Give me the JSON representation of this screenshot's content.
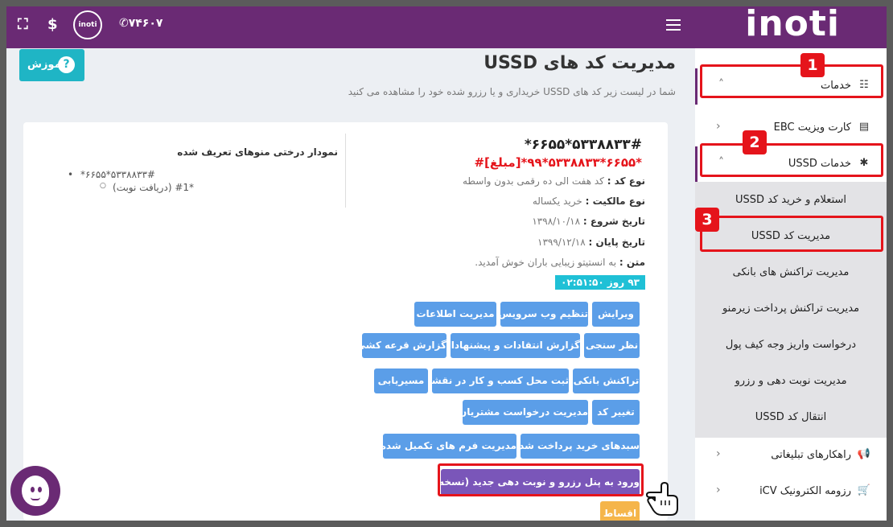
{
  "header": {
    "logo": "inoti",
    "avatar_text": "inoti",
    "phone": "۷۴۶۰۷",
    "dollar": "$"
  },
  "sidebar": {
    "items": [
      {
        "label": "خدمات",
        "icon": "sliders-icon"
      },
      {
        "label": "کارت ویزیت EBC",
        "icon": "id-card-icon"
      },
      {
        "label": "خدمات USSD",
        "icon": "gear-icon"
      },
      {
        "label": "راهکارهای تبلیغاتی",
        "icon": "megaphone-icon"
      },
      {
        "label": "رزومه الکترونیک iCV",
        "icon": "cart-icon"
      }
    ],
    "sub_items": [
      {
        "label": "استعلام و خرید کد USSD"
      },
      {
        "label": "مدیریت کد USSD"
      },
      {
        "label": "مدیریت تراکنش های بانکی"
      },
      {
        "label": "مدیریت تراکنش پرداخت زیرمنو"
      },
      {
        "label": "درخواست واریز وجه کیف پول"
      },
      {
        "label": "مدیریت نوبت دهی و رزرو"
      },
      {
        "label": "انتقال کد USSD"
      }
    ]
  },
  "badges": [
    "1",
    "2",
    "3"
  ],
  "main": {
    "tutorial_label": "آموزش",
    "title": "مدیریت کد های USSD",
    "subtitle": "شما در لیست زیر کد های USSD خریداری و یا رزرو شده خود را مشاهده می کنید",
    "ussd_code": "*۶۶۵۵*۵۳۳۸۸۳۳#",
    "ussd_pay_code": "*۶۶۵۵*۵۳۳۸۸۳۳*۹۹*[مبلغ]#",
    "code_type_label": "نوع کد :",
    "code_type": "کد هفت الی ده رقمی بدون واسطه",
    "ownership_label": "نوع مالکیت :",
    "ownership": "خرید یکساله",
    "start_label": "تاریخ شروع :",
    "start_date": "۱۳۹۸/۱۰/۱۸",
    "end_label": "تاریخ پایان :",
    "end_date": "۱۳۹۹/۱۲/۱۸",
    "text_label": "متن :",
    "text_value": "به انستیتو زیبایی باران خوش آمدید.",
    "timer": "۹۳ روز ۰۲:۵۱:۵۰",
    "tree_title": "نمودار درختی منوهای تعریف شده",
    "tree_root": "*۶۶۵۵*۵۳۳۸۸۳۳#",
    "tree_child": "(دریافت نوبت) #1*"
  },
  "buttons": {
    "edit": "ویرایش",
    "web_service": "تنظیم وب سرویس",
    "info": "مدیریت اطلاعات",
    "survey": "نظر سنجی",
    "feedback": "گزارش انتقادات و پیشنهادات",
    "lottery": "گزارش قرعه کشی",
    "bank_tx": "تراکنش بانکی",
    "map": "ثبت محل کسب و کار در نقشه",
    "routing": "مسیریابی",
    "change_code": "تغییر کد",
    "customer_requests": "مدیریت درخواست مشتریان",
    "paid_baskets": "سبدهای خرید پرداخت شده",
    "forms": "مدیریت فرم های تکمیل شده",
    "reserve_panel": "ورود به پنل رزرو و نوبت دهی جدید (نسخه بتا)",
    "installments": "اقساط"
  },
  "colors": {
    "brand_purple": "#6a2a74",
    "accent_cyan": "#1fb5c5",
    "button_blue": "#5b9ee8",
    "callout_red": "#e5141b",
    "beta_purple": "#7a56b9",
    "orange": "#f5b54a"
  }
}
